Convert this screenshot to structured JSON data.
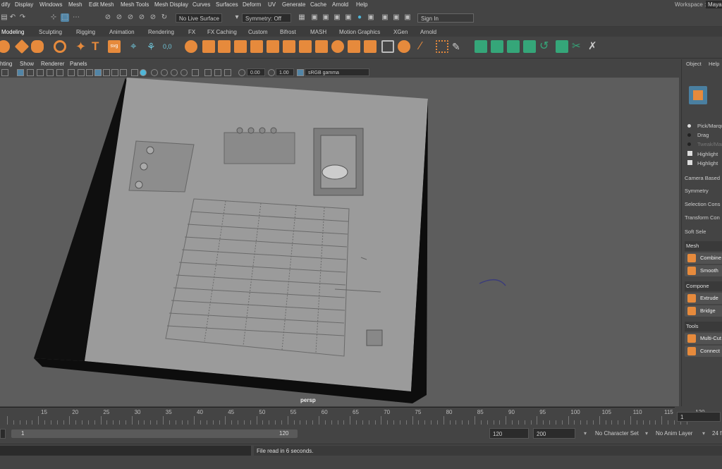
{
  "menubar": {
    "items": [
      "dify",
      "Display",
      "Windows",
      "Mesh",
      "Edit Mesh",
      "Mesh Tools",
      "Mesh Display",
      "Curves",
      "Surfaces",
      "Deform",
      "UV",
      "Generate",
      "Cache",
      "Arnold",
      "Help"
    ],
    "workspace_label": "Workspace :",
    "workspace_value": "Maya"
  },
  "statusline": {
    "live_surface": "No Live Surface",
    "symmetry": "Symmetry: Off",
    "sign_in": "Sign In"
  },
  "shelf": {
    "tabs": [
      "Modeling",
      "Sculpting",
      "Rigging",
      "Animation",
      "Rendering",
      "FX",
      "FX Caching",
      "Custom",
      "Bifrost",
      "MASH",
      "Motion Graphics",
      "XGen",
      "Arnold"
    ],
    "active_tab": "Modeling",
    "icon_names": [
      "poly-sphere-icon",
      "poly-cube-icon",
      "poly-cylinder-icon",
      "poly-torus-icon",
      "sparkle-icon",
      "text-icon",
      "svg-icon",
      "camera-icon",
      "mesh-icon",
      "lattice-icon"
    ]
  },
  "viewport_panel": {
    "menus": [
      "hting",
      "Show",
      "Renderer",
      "Panels"
    ],
    "exposure": "0.00",
    "gamma": "1.00",
    "color_space": "sRGB gamma",
    "camera_label": "persp"
  },
  "right_panel": {
    "tabs": [
      "Object",
      "Help"
    ],
    "options": [
      "Pick/Marqu",
      "Drag",
      "Tweak/Mar",
      "Highlight",
      "Highlight"
    ],
    "camera_based": "Camera Based",
    "symmetry": "Symmetry",
    "selection_const": "Selection Cons",
    "transform_const": "Transform Con",
    "soft_select": "Soft Sele",
    "sections": [
      {
        "title": "Mesh",
        "tools": [
          "Combine",
          "Smooth"
        ]
      },
      {
        "title": "Compone",
        "tools": [
          "Extrude",
          "Bridge"
        ]
      },
      {
        "title": "Tools",
        "tools": [
          "Multi-Cut",
          "Connect"
        ]
      }
    ]
  },
  "timeline": {
    "ticks": [
      "15",
      "20",
      "25",
      "30",
      "35",
      "40",
      "45",
      "50",
      "55",
      "60",
      "65",
      "70",
      "75",
      "80",
      "85",
      "90",
      "95",
      "100",
      "105",
      "110",
      "115",
      "120"
    ],
    "current_frame": "1"
  },
  "range": {
    "start": "1",
    "end": "120",
    "anim_end": "120",
    "max": "200",
    "character_set": "No Character Set",
    "anim_layer": "No Anim Layer",
    "fps": "24 f"
  },
  "command": {
    "message": "File read in  6 seconds."
  }
}
